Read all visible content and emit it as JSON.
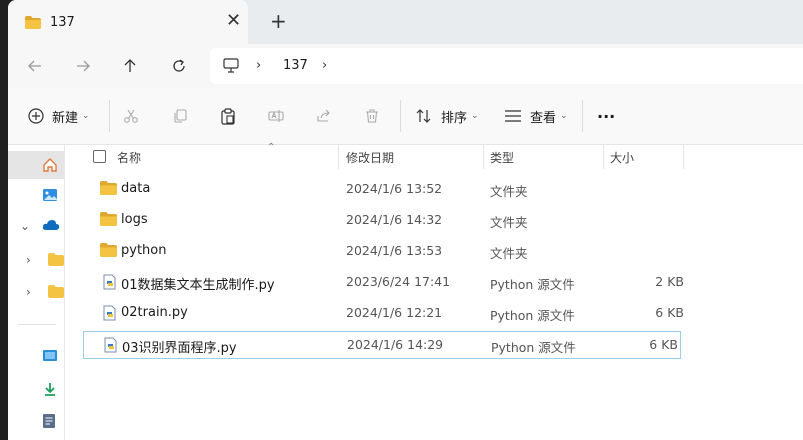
{
  "tab": {
    "title": "137",
    "close": "✕",
    "new": "+"
  },
  "address": {
    "separator": "›",
    "crumb": "137"
  },
  "toolbar": {
    "new_label": "新建",
    "sort_label": "排序",
    "view_label": "查看",
    "more_label": "···",
    "dropdown": "⌄"
  },
  "columns": {
    "name": "名称",
    "modified": "修改日期",
    "type": "类型",
    "size": "大小"
  },
  "files": [
    {
      "name": "data",
      "modified": "2024/1/6 13:52",
      "type": "文件夹",
      "size": "",
      "kind": "folder"
    },
    {
      "name": "logs",
      "modified": "2024/1/6 14:32",
      "type": "文件夹",
      "size": "",
      "kind": "folder"
    },
    {
      "name": "python",
      "modified": "2024/1/6 13:53",
      "type": "文件夹",
      "size": "",
      "kind": "folder"
    },
    {
      "name": "01数据集文本生成制作.py",
      "modified": "2023/6/24 17:41",
      "type": "Python 源文件",
      "size": "2 KB",
      "kind": "py"
    },
    {
      "name": "02train.py",
      "modified": "2024/1/6 12:21",
      "type": "Python 源文件",
      "size": "6 KB",
      "kind": "py"
    },
    {
      "name": "03识别界面程序.py",
      "modified": "2024/1/6 14:29",
      "type": "Python 源文件",
      "size": "6 KB",
      "kind": "py"
    }
  ],
  "colors": {
    "folder": "#f5c342",
    "folder_dark": "#e0a82e",
    "accent": "#0067c0",
    "selection_border": "#99d0e8"
  }
}
